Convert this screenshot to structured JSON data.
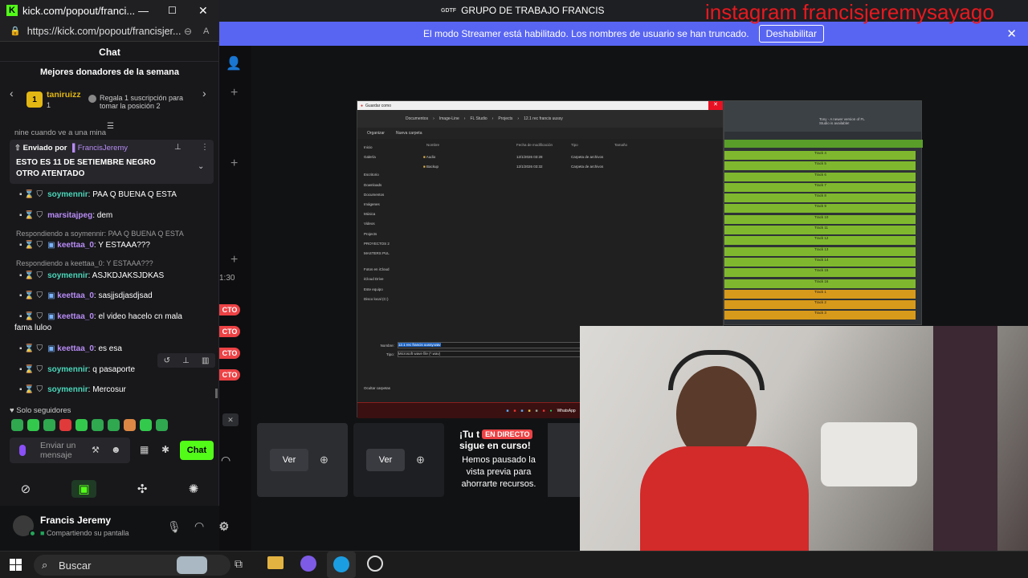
{
  "window": {
    "url": "kick.com/popout/franci...",
    "address": "https://kick.com/popout/francisjer...",
    "title": "GRUPO DE TRABAJO FRANCIS"
  },
  "overlay_text": "instagram francisjeremysayago",
  "streamer_bar": {
    "message": "El modo Streamer está habilitado. Los nombres de usuario se han truncado.",
    "button": "Deshabilitar"
  },
  "chat": {
    "header": "Chat",
    "top_donors_title": "Mejores donadores de la semana",
    "donor": {
      "rank": "1",
      "name": "taniruizz",
      "count": "1"
    },
    "gift_prompt": "Regala 1 suscripción para tomar la posición 2",
    "cut_message": "nine cuando ve a una mina",
    "pinned": {
      "sent_by_label": "Enviado por",
      "sent_by_user": "FrancisJeremy",
      "text": "ESTO ES 11 DE SETIEMBRE NEGRO OTRO ATENTADO"
    },
    "messages": [
      {
        "user": "soymennir",
        "text": ": PAA Q BUENA Q ESTA"
      },
      {
        "user": "marsitajpeg",
        "text": ": dem"
      },
      {
        "reply_to": "Respondiendo a soymennir: PAA Q BUENA Q ESTA",
        "user": "keettaa_0",
        "text": ": Y ESTAAA???"
      },
      {
        "reply_to": "Respondiendo a keettaa_0: Y ESTAAA???",
        "user": "soymennir",
        "text": ": ASJKDJAKSJDKAS"
      },
      {
        "user": "keettaa_0",
        "text": ": sasjjsdjasdjsad"
      },
      {
        "user": "keettaa_0",
        "text": ": el video hacelo cn mala",
        "text2": "fama luloo"
      },
      {
        "user": "keettaa_0",
        "text": ": es esa"
      },
      {
        "user": "soymennir",
        "text": ": q pasaporte"
      },
      {
        "user": "soymennir",
        "text": ": Mercosur"
      }
    ],
    "followers_only": "Solo seguidores",
    "input_placeholder": "Enviar un mensaje",
    "send_button": "Chat"
  },
  "discord": {
    "time_fragment": "1:30",
    "live_fragments": [
      "CTO",
      "CTO",
      "CTO",
      "CTO"
    ],
    "ver_label": "Ver",
    "preview_paused": {
      "line1": "¡Tu t",
      "badge": "EN DIRECTO",
      "line2": "sigue en curso!",
      "body": "Hemos pausado la vista previa para ahorrarte recursos."
    },
    "user": {
      "name": "Francis Jeremy",
      "status": "Compartiendo su pantalla"
    }
  },
  "shared_screen": {
    "dialog_title": "Guardar como",
    "path": [
      "Documentos",
      "Image-Line",
      "FL Studio",
      "Projects",
      "12.1 rec francis uussy"
    ],
    "organize": "Organizar",
    "new_folder": "Nueva carpeta",
    "columns": [
      "Nombre",
      "Fecha de modificación",
      "Tipo",
      "Tamaño"
    ],
    "files": [
      {
        "name": "Audio",
        "date": "12/1/2026 03:28",
        "type": "Carpeta de archivos"
      },
      {
        "name": "Backup",
        "date": "12/1/2026 03:32",
        "type": "Carpeta de archivos"
      }
    ],
    "nav": [
      "Inicio",
      "Galería",
      "Escritorio",
      "Downloads",
      "Documentos",
      "Imágenes",
      "Música",
      "Videos",
      "Projects",
      "PROYECTOS 2",
      "MASTERS PUL",
      "Fotos en iCloud",
      "iCloud Drive",
      "Este equipo",
      "Disco local (C:)"
    ],
    "filename_label": "Nombre:",
    "filename": "12.1 rec francis uussy.wav",
    "type_label": "Tipo:",
    "type_value": "Microsoft wave file (*.wav)",
    "hide_folders": "Ocultar carpetas",
    "fl_tracks": [
      "Track 4",
      "Track 5",
      "Track 6",
      "Track 7",
      "Track 8",
      "Track 9",
      "Track 10",
      "Track 11",
      "Track 12",
      "Track 13",
      "Track 14",
      "Track 15",
      "Track 16",
      "Track 1",
      "Track 2",
      "Track 3"
    ],
    "fl_notice": "Tony - A newer version of FL Studio is available!",
    "taskbar_app": "WhatsApp"
  },
  "taskbar": {
    "search": "Buscar"
  },
  "colors": {
    "kick_green": "#53fc18",
    "discord_blurple": "#5865f2",
    "live_red": "#ed4245"
  }
}
